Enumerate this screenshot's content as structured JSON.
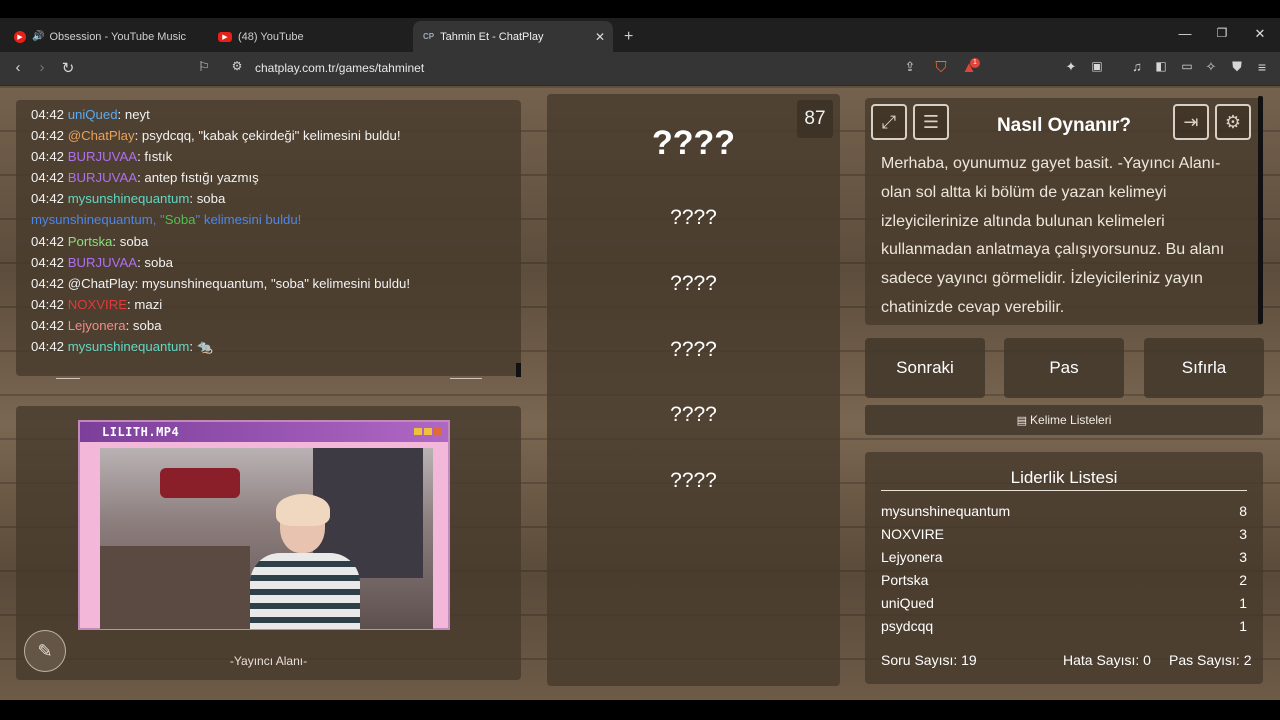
{
  "browser": {
    "tabs": [
      {
        "label": "Obsession - YouTube Music"
      },
      {
        "label": "(48) YouTube"
      },
      {
        "label": "Tahmin Et - ChatPlay",
        "favicon": "CP"
      }
    ],
    "url": "chatplay.com.tr/games/tahminet",
    "notification_count": "1"
  },
  "chat": {
    "lines": [
      {
        "time": "04:42",
        "user": "uniQued",
        "msg": ": neyt"
      },
      {
        "time": "04:42",
        "user": "@ChatPlay",
        "msg": ": psydcqq, \"kabak çekirdeği\" kelimesini buldu!"
      },
      {
        "time": "04:42",
        "user": "BURJUVAA",
        "msg": ": fıstık"
      },
      {
        "time": "04:42",
        "user": "BURJUVAA",
        "msg": ": antep fıstığı yazmış"
      },
      {
        "time": "04:42",
        "user": "mysunshinequantum",
        "msg": ": soba"
      },
      {
        "pre": "mysunshinequantum, \"",
        "word": "Soba",
        "post": "\" kelimesini buldu!"
      },
      {
        "time": "04:42",
        "user": "Portska",
        "msg": ": soba"
      },
      {
        "time": "04:42",
        "user": "BURJUVAA",
        "msg": ": soba"
      },
      {
        "time": "04:42",
        "user": "@ChatPlay",
        "msg": ": mysunshinequantum, \"soba\" kelimesini buldu!"
      },
      {
        "time": "04:42",
        "user": "NOXVIRE",
        "msg": ": mazi"
      },
      {
        "time": "04:42",
        "user": "Lejyonera",
        "msg": ": soba"
      },
      {
        "time": "04:42",
        "user": "mysunshinequantum",
        "msg": ": 🐀"
      }
    ]
  },
  "video": {
    "title": "LILITH.MP4",
    "caption": "-Yayıncı Alanı-"
  },
  "game": {
    "counter": "87",
    "words": [
      "????",
      "????",
      "????",
      "????",
      "????",
      "????"
    ]
  },
  "howto": {
    "title": "Nasıl Oynanır?",
    "text": "Merhaba, oyunumuz gayet basit. -Yayıncı Alanı- olan sol altta ki bölüm de yazan kelimeyi izleyicilerinize altında bulunan kelimeleri kullanmadan anlatmaya çalışıyorsunuz. Bu alanı sadece yayıncı görmelidir. İzleyicileriniz yayın chatinizde cevap verebilir."
  },
  "buttons": {
    "next": "Sonraki",
    "pass": "Pas",
    "reset": "Sıfırla",
    "word_lists": "Kelime Listeleri"
  },
  "leaderboard": {
    "title": "Liderlik Listesi",
    "rows": [
      {
        "name": "mysunshinequantum",
        "score": "8"
      },
      {
        "name": "NOXVIRE",
        "score": "3"
      },
      {
        "name": "Lejyonera",
        "score": "3"
      },
      {
        "name": "Portska",
        "score": "2"
      },
      {
        "name": "uniQued",
        "score": "1"
      },
      {
        "name": "psydcqq",
        "score": "1"
      }
    ]
  },
  "stats": {
    "questions": "Soru Sayısı: 19",
    "errors": "Hata Sayısı: 0",
    "passes": "Pas Sayısı: 2"
  }
}
